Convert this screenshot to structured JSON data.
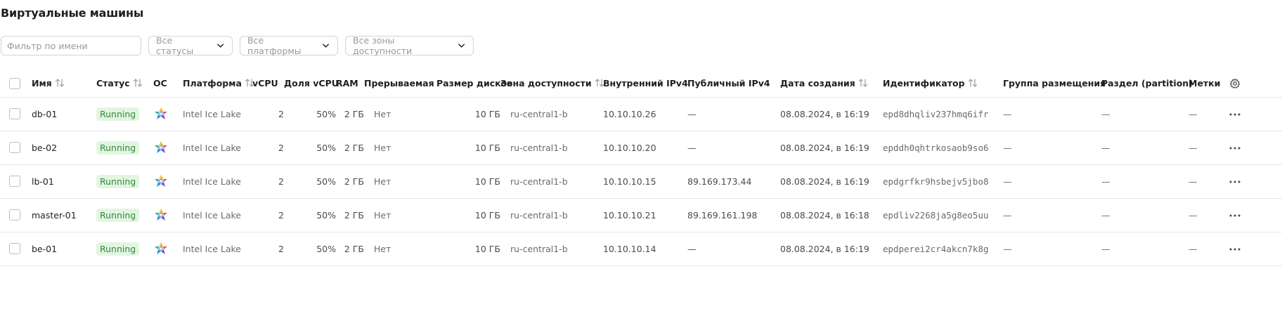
{
  "page": {
    "title": "Виртуальные машины"
  },
  "filters": {
    "name_placeholder": "Фильтр по имени",
    "status_select": "Все статусы",
    "platform_select": "Все платформы",
    "zone_select": "Все зоны доступности"
  },
  "columns": {
    "name": "Имя",
    "status": "Статус",
    "os": "ОС",
    "platform": "Платформа",
    "vcpu": "vCPU",
    "vcpu_share": "Доля vCPU",
    "ram": "RAM",
    "preemptible": "Прерываемая",
    "disk_size": "Размер дисков",
    "zone": "Зона доступности",
    "internal_ip": "Внутренний IPv4",
    "public_ip": "Публичный IPv4",
    "created": "Дата создания",
    "id": "Идентификатор",
    "placement_group": "Группа размещения",
    "partition": "Раздел (partition)",
    "labels": "Метки"
  },
  "rows": [
    {
      "name": "db-01",
      "status": "Running",
      "platform": "Intel Ice Lake",
      "vcpu": "2",
      "vcpu_share": "50%",
      "ram": "2 ГБ",
      "preemptible": "Нет",
      "disk_size": "10 ГБ",
      "zone": "ru-central1-b",
      "internal_ip": "10.10.10.26",
      "public_ip": "—",
      "created": "08.08.2024, в 16:19",
      "id": "epd8dhqliv237hmq6ifr",
      "placement_group": "—",
      "partition": "—",
      "labels": "—"
    },
    {
      "name": "be-02",
      "status": "Running",
      "platform": "Intel Ice Lake",
      "vcpu": "2",
      "vcpu_share": "50%",
      "ram": "2 ГБ",
      "preemptible": "Нет",
      "disk_size": "10 ГБ",
      "zone": "ru-central1-b",
      "internal_ip": "10.10.10.20",
      "public_ip": "—",
      "created": "08.08.2024, в 16:19",
      "id": "epddh0qhtrkosaob9so6",
      "placement_group": "—",
      "partition": "—",
      "labels": "—"
    },
    {
      "name": "lb-01",
      "status": "Running",
      "platform": "Intel Ice Lake",
      "vcpu": "2",
      "vcpu_share": "50%",
      "ram": "2 ГБ",
      "preemptible": "Нет",
      "disk_size": "10 ГБ",
      "zone": "ru-central1-b",
      "internal_ip": "10.10.10.15",
      "public_ip": "89.169.173.44",
      "created": "08.08.2024, в 16:19",
      "id": "epdgrfkr9hsbejv5jbo8",
      "placement_group": "—",
      "partition": "—",
      "labels": "—"
    },
    {
      "name": "master-01",
      "status": "Running",
      "platform": "Intel Ice Lake",
      "vcpu": "2",
      "vcpu_share": "50%",
      "ram": "2 ГБ",
      "preemptible": "Нет",
      "disk_size": "10 ГБ",
      "zone": "ru-central1-b",
      "internal_ip": "10.10.10.21",
      "public_ip": "89.169.161.198",
      "created": "08.08.2024, в 16:18",
      "id": "epdliv2268ja5g8eo5uu",
      "placement_group": "—",
      "partition": "—",
      "labels": "—"
    },
    {
      "name": "be-01",
      "status": "Running",
      "platform": "Intel Ice Lake",
      "vcpu": "2",
      "vcpu_share": "50%",
      "ram": "2 ГБ",
      "preemptible": "Нет",
      "disk_size": "10 ГБ",
      "zone": "ru-central1-b",
      "internal_ip": "10.10.10.14",
      "public_ip": "—",
      "created": "08.08.2024, в 16:19",
      "id": "epdperei2cr4akcn7k8g",
      "placement_group": "—",
      "partition": "—",
      "labels": "—"
    }
  ],
  "icons": {
    "os": "linux-distro-logo-icon",
    "sort": "sort-arrows-icon",
    "actions": "more-horizontal-icon",
    "settings": "gear-icon",
    "chevron": "chevron-down-icon"
  },
  "colors": {
    "status_bg": "#e3f5e1",
    "status_text": "#2e8b3a",
    "border": "#e6e6e6"
  }
}
